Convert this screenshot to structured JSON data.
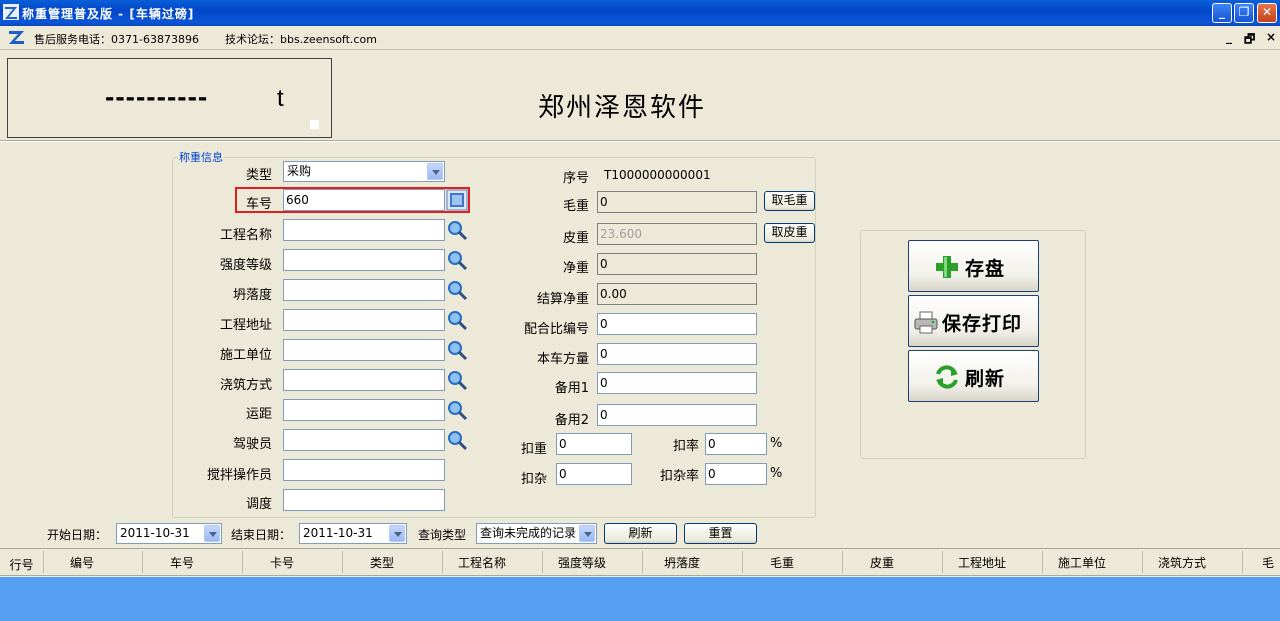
{
  "window": {
    "title": "称重管理普及版 - [车辆过磅]",
    "min": "_",
    "max": "❐",
    "close": "✕"
  },
  "info": {
    "phone": "售后服务电话：0371-63873896",
    "forum": "技术论坛：bbs.zeensoft.com",
    "mdi_min": "_",
    "mdi_restore": "🗗",
    "mdi_close": "×"
  },
  "display": {
    "weight": "----------",
    "unit": "t",
    "company": "郑州泽恩软件"
  },
  "form": {
    "legend": "称重信息",
    "type": {
      "label": "类型",
      "value": "采购"
    },
    "plate": {
      "label": "车号",
      "value": "660"
    },
    "project": {
      "label": "工程名称",
      "value": ""
    },
    "grade": {
      "label": "强度等级",
      "value": ""
    },
    "slump": {
      "label": "坍落度",
      "value": ""
    },
    "address": {
      "label": "工程地址",
      "value": ""
    },
    "builder": {
      "label": "施工单位",
      "value": ""
    },
    "pour": {
      "label": "浇筑方式",
      "value": ""
    },
    "distance": {
      "label": "运距",
      "value": ""
    },
    "driver": {
      "label": "驾驶员",
      "value": ""
    },
    "mixer": {
      "label": "搅拌操作员",
      "value": ""
    },
    "dispatch": {
      "label": "调度",
      "value": ""
    },
    "serial": {
      "label": "序号",
      "value": "T1000000000001"
    },
    "gross": {
      "label": "毛重",
      "value": "0",
      "button": "取毛重"
    },
    "tare": {
      "label": "皮重",
      "value": "23.600",
      "button": "取皮重"
    },
    "net": {
      "label": "净重",
      "value": "0"
    },
    "settle": {
      "label": "结算净重",
      "value": "0.00"
    },
    "mixno": {
      "label": "配合比编号",
      "value": "0"
    },
    "volume": {
      "label": "本车方量",
      "value": "0"
    },
    "spare1": {
      "label": "备用1",
      "value": "0"
    },
    "spare2": {
      "label": "备用2",
      "value": "0"
    },
    "deduct": {
      "label": "扣重",
      "value": "0"
    },
    "deduct_rate": {
      "label": "扣率",
      "value": "0",
      "unit": "%"
    },
    "impurity": {
      "label": "扣杂",
      "value": "0"
    },
    "impurity_rate": {
      "label": "扣杂率",
      "value": "0",
      "unit": "%"
    }
  },
  "actions": {
    "save": "存盘",
    "save_print": "保存打印",
    "refresh": "刷新"
  },
  "filter": {
    "start_label": "开始日期：",
    "start_value": "2011-10-31",
    "end_label": "结束日期：",
    "end_value": "2011-10-31",
    "type_label": "查询类型",
    "type_value": "查询未完成的记录",
    "refresh": "刷新",
    "reset": "重置"
  },
  "grid": {
    "columns": [
      "行号",
      "编号",
      "车号",
      "卡号",
      "类型",
      "工程名称",
      "强度等级",
      "坍落度",
      "毛重",
      "皮重",
      "工程地址",
      "施工单位",
      "浇筑方式",
      "毛"
    ]
  }
}
